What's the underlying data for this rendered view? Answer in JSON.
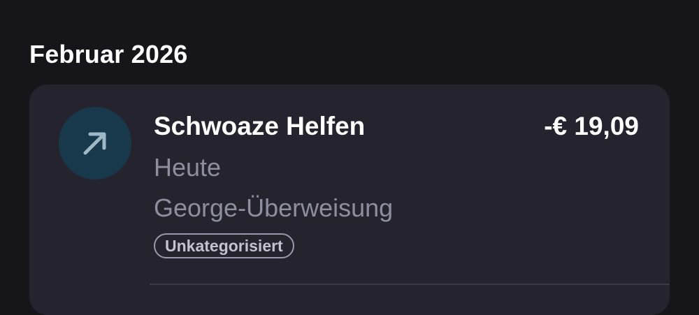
{
  "section": {
    "month_label": "Februar 2026"
  },
  "transaction": {
    "icon": "arrow-up-right-icon",
    "name": "Schwoaze Helfen",
    "amount": "-€ 19,09",
    "date": "Heute",
    "type": "George-Überweisung",
    "category": "Unkategorisiert"
  },
  "colors": {
    "background": "#16151a",
    "card": "#25242e",
    "icon_circle": "#17394b",
    "secondary_text": "#8f8e9e"
  }
}
